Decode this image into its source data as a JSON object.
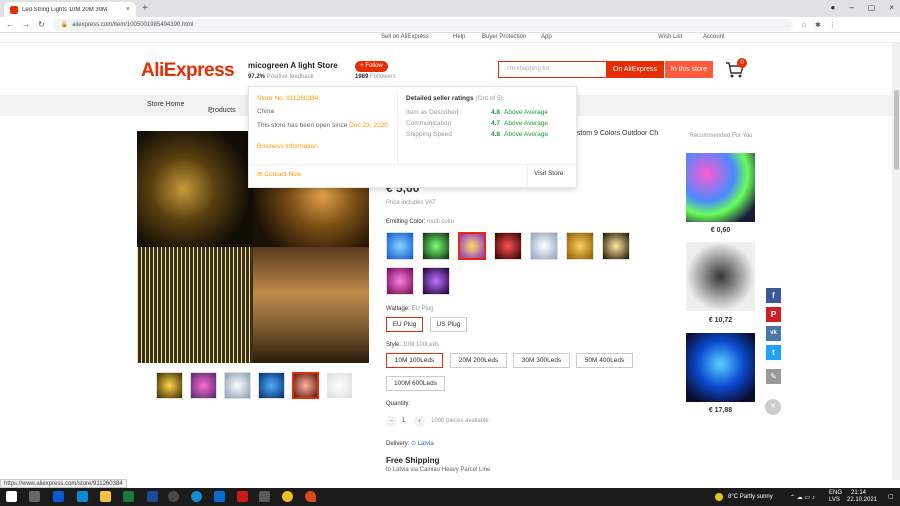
{
  "browser": {
    "tab_title": "Led String Lights 10M 20M 30M",
    "tab_close": "×",
    "new_tab": "+",
    "url": "aliexpress.com/item/1005001985494390.html",
    "window_controls": [
      "●",
      "–",
      "▢",
      "×"
    ]
  },
  "topbar": {
    "sell": "Sell on AliExpress",
    "help": "Help",
    "buyer_protection": "Buyer Protection",
    "app": "App",
    "wishlist": "Wish List",
    "account": "Account"
  },
  "header": {
    "logo": "AliExpress",
    "store_name": "micogreen A light Store",
    "feedback_pct": "97.2%",
    "feedback_label": "Positive feedback",
    "follow": "+ Follow",
    "followers_count": "1989",
    "followers_label": "Followers",
    "search_placeholder": "I'm shopping for",
    "btn_ali": "On AliExpress",
    "btn_store": "In this store",
    "cart_count": "0"
  },
  "store_nav": {
    "store_home": "Store Home",
    "products": "Products"
  },
  "popup": {
    "store_no": "Store No. 911260384",
    "country": "China",
    "open_since_prefix": "This store has been open since",
    "open_since_date": "Dec 23, 2020",
    "business_info": "Business Information",
    "contact": "Contact Now",
    "ratings_title": "Detailed seller ratings",
    "ratings_sub": "(Out of 5)",
    "ratings": [
      {
        "label": "Item as Described",
        "score": "4.8",
        "comment": "Above Average"
      },
      {
        "label": "Communication",
        "score": "4.7",
        "comment": "Above Average"
      },
      {
        "label": "Shipping Speed",
        "score": "4.8",
        "comment": "Above Average"
      }
    ],
    "visit_store": "Visit Store"
  },
  "product": {
    "title": "ustom 9 Colors Outdoor Ch",
    "price": "€ 5,60",
    "price_note": "Price includes VAT",
    "color_label": "Emitting Color:",
    "color_value": "multi color",
    "wattage_label": "Wattage:",
    "wattage_value": "EU Plug",
    "plugs": [
      "EU Plug",
      "US Plug"
    ],
    "style_label": "Style:",
    "style_value": "10M 100Leds",
    "styles": [
      "10M 100Leds",
      "20M 200Leds",
      "30M 300Leds",
      "50M 400Leds",
      "100M 600Leds"
    ],
    "quantity_label": "Quantity:",
    "qty_minus": "−",
    "qty_value": "1",
    "qty_plus": "+",
    "available": "1000 pieces available",
    "delivery_label": "Delivery:",
    "delivery_value": "Latvia",
    "shipping": "Free Shipping",
    "shipping_sub": "to Latvia via Cainiao Heavy Parcel Line"
  },
  "recommended": {
    "title": "Recommended For You",
    "items": [
      {
        "price": "€ 0,60"
      },
      {
        "price": "€ 10,72"
      },
      {
        "price": "€ 17,88"
      }
    ]
  },
  "social": {
    "fb": "f",
    "pinterest": "P",
    "vk": "vk",
    "twitter": "t",
    "edit": "✎",
    "close": "×"
  },
  "status_url": "https://www.aliexpress.com/store/911260384",
  "taskbar": {
    "weather": "8°C  Partly sunny",
    "lang": "ENG",
    "region": "LVS",
    "time": "21:14",
    "date": "22.10.2021"
  },
  "colors": {
    "accent": "#e62e04",
    "rating_green": "#1aa032",
    "orange": "#f90"
  }
}
